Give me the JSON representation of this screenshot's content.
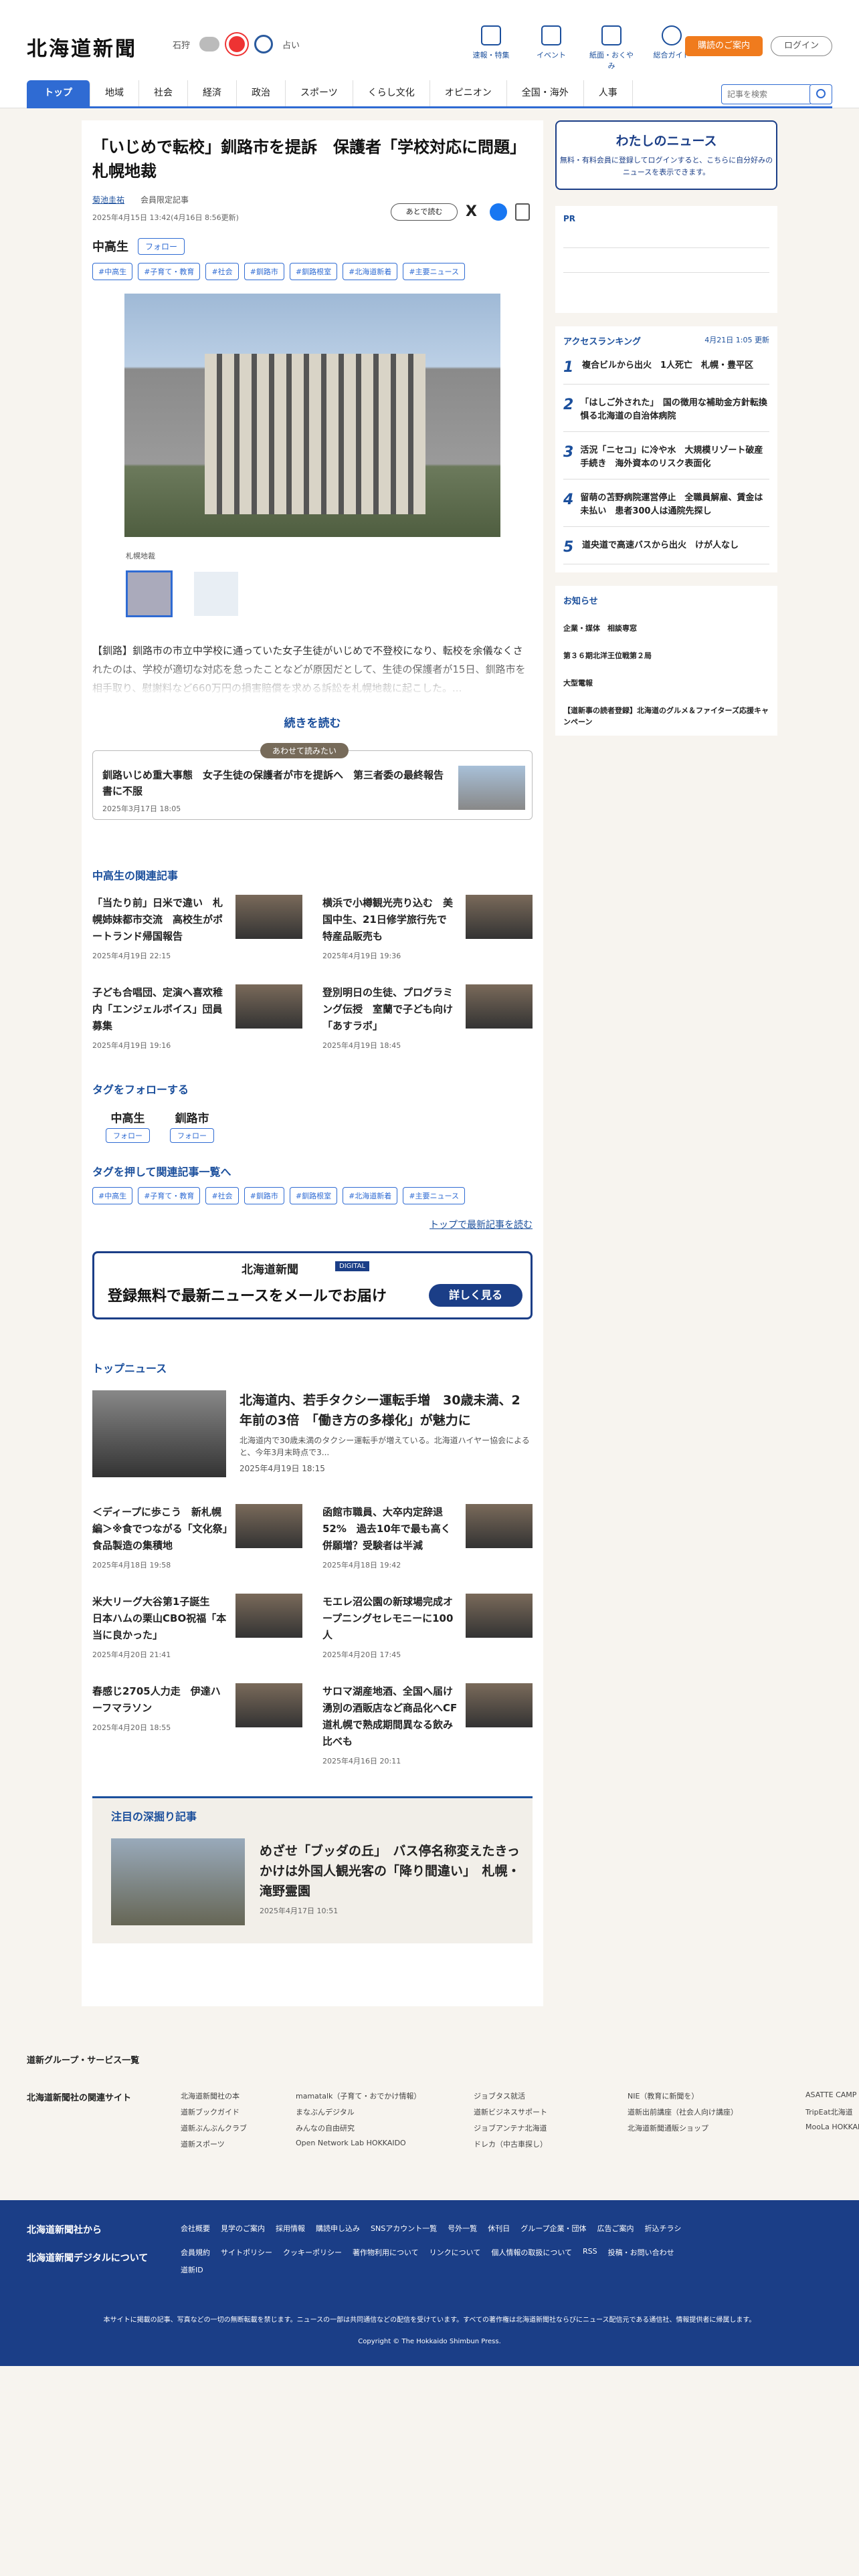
{
  "header": {
    "logo": "北海道新聞",
    "weather_city": "石狩",
    "weather_extra": "占い",
    "top_icons": [
      "速報・特集",
      "イベント",
      "紙面・おくやみ",
      "総合ガイド"
    ],
    "subscribe": "購読のご案内",
    "login": "ログイン",
    "search_placeholder": "記事を検索"
  },
  "nav": [
    "トップ",
    "地域",
    "社会",
    "経済",
    "政治",
    "スポーツ",
    "くらし文化",
    "オピニオン",
    "全国・海外",
    "人事"
  ],
  "article": {
    "title": "「いじめで転校」釧路市を提訴　保護者「学校対応に問題」　札幌地裁",
    "author": "菊池圭祐",
    "member": "会員限定記事",
    "date": "2025年4月15日 13:42(4月16日 8:56更新)",
    "later": "あとで読む",
    "topic": "中高生",
    "follow": "フォロー",
    "tags": [
      "#中高生",
      "#子育て・教育",
      "#社会",
      "#釧路市",
      "#釧路根室",
      "#北海道新着",
      "#主要ニュース"
    ],
    "caption": "札幌地裁",
    "body": "【釧路】釧路市の市立中学校に通っていた女子生徒がいじめで不登校になり、転校を余儀なくされたのは、学校が適切な対応を怠ったことなどが原因だとして、生徒の保護者が15日、釧路市を相手取り、慰謝料など660万円の損害賠償を求める訴訟を札幌地裁に起こした。...",
    "readmore": "続きを読む"
  },
  "also": {
    "label": "あわせて読みたい",
    "title": "釧路いじめ重大事態　女子生徒の保護者が市を提訴へ　第三者委の最終報告書に不服",
    "date": "2025年3月17日 18:05"
  },
  "related_head": "中高生の関連記事",
  "related": [
    {
      "t": "「当たり前」日米で違い　札幌姉妹都市交流　高校生がポートランド帰国報告",
      "d": "2025年4月19日 22:15"
    },
    {
      "t": "横浜で小樽観光売り込む　美国中生、21日修学旅行先で　特産品販売も",
      "d": "2025年4月19日 19:36"
    },
    {
      "t": "子ども合唱団、定演へ喜欢稚内「エンジェルボイス」団員募集",
      "d": "2025年4月19日 19:16"
    },
    {
      "t": "登別明日の生徒、プログラミング伝授　室蘭で子ども向け「あすラボ」",
      "d": "2025年4月19日 18:45"
    }
  ],
  "tagfollow_head": "タグをフォローする",
  "tagfollow": [
    {
      "n": "中高生",
      "f": "フォロー"
    },
    {
      "n": "釧路市",
      "f": "フォロー"
    }
  ],
  "tagsearch_head": "タグを押して関連記事一覧へ",
  "toplink": "トップで最新記事を読む",
  "promo": {
    "logo": "北海道新聞",
    "digital": "DIGITAL",
    "text": "登録無料で最新ニュースをメールでお届け",
    "btn": "詳しく見る"
  },
  "topnews_head": "トップニュース",
  "topnews": {
    "t": "北海道内、若手タクシー運転手増　30歳未満、2年前の3倍　「働き方の多様化」が魅力に",
    "s": "北海道内で30歳未満のタクシー運転手が増えている。北海道ハイヤー協会によると、今年3月末時点で3...",
    "d": "2025年4月19日 18:15"
  },
  "topgrid": [
    {
      "t": "＜ディープに歩こう　新札幌編＞※食でつながる「文化祭」　食品製造の集積地",
      "d": "2025年4月18日 19:58"
    },
    {
      "t": "函館市職員、大卒内定辞退52%　過去10年で最も高く　併願増？受験者は半減",
      "d": "2025年4月18日 19:42"
    },
    {
      "t": "米大リーグ大谷第1子誕生　日本ハムの栗山CBO祝福「本当に良かった」",
      "d": "2025年4月20日 21:41"
    },
    {
      "t": "モエレ沼公園の新球場完成オープニングセレモニーに100人",
      "d": "2025年4月20日 17:45"
    },
    {
      "t": "春感じ2705人力走　伊達ハーフマラソン",
      "d": "2025年4月20日 18:55"
    },
    {
      "t": "サロマ湖産地酒、全国へ届け　湧別の酒販店など商品化へCF　道札幌で熟成期間異なる飲み比べも",
      "d": "2025年4月16日 20:11"
    }
  ],
  "deep": {
    "h": "注目の深掘り記事",
    "t": "めざせ「ブッダの丘」　バス停名称変えたきっかけは外国人観光客の「降り間違い」　札幌・滝野霊園",
    "d": "2025年4月17日 10:51"
  },
  "side": {
    "mynews_h": "わたしのニュース",
    "mynews_s": "無料・有料会員に登録してログインすると、こちらに自分好みのニュースを表示できます。",
    "pr": "PR",
    "rank_h": "アクセスランキング",
    "rank_u": "4月21日 1:05 更新",
    "rank": [
      "複合ビルから出火　1人死亡　札幌・豊平区",
      "「はしご外された」　国の徴用な補助金方針転換　惧る北海道の自治体病院",
      "活況「ニセコ」に冷や水　大規模リゾート破産手続き　海外資本のリスク表面化",
      "留萌の苫野病院運営停止　全職員解雇、賃金は未払い　患者300人は通院先探し",
      "道央道で高速バスから出火　けが人なし"
    ],
    "notice_h": "お知らせ",
    "notices": [
      "企業・媒体　相談専窓",
      "第３６期北洋王位戦第２局",
      "大型電報",
      "【道新事の読者登録】北海道のグルメ＆ファイターズ応援キャンペーン"
    ]
  },
  "footer": {
    "group": "道新グループ・サービス一覧",
    "related_l": "北海道新聞社の関連サイト",
    "cols": [
      "北海道新聞社の本",
      "mamatalk（子育て・おでかけ情報）",
      "ジョブタス就活",
      "NIE（教育に新聞を）",
      "ASATTE CAMP",
      "道新ブックガイド",
      "まなぶんデジタル",
      "道新ビジネスサポート",
      "道新出前講座（社会人向け講座）",
      "TripEat北海道",
      "道新ぶんぶんクラブ",
      "みんなの自由研究",
      "ジョブアンテナ北海道",
      "北海道新聞通販ショップ",
      "MooLa HOKKAIDO",
      "道新スポーツ",
      "Open Network Lab HOKKAIDO",
      "ドレカ（中古車探し）",
      "",
      ""
    ],
    "bf1": "北海道新聞社から",
    "bf2": "北海道新聞デジタルについて",
    "links1": [
      "会社概要",
      "見学のご案内",
      "採用情報",
      "購読申し込み",
      "SNSアカウント一覧",
      "号外一覧",
      "休刊日",
      "グループ企業・団体",
      "広告ご案内",
      "折込チラシ"
    ],
    "links2": [
      "会員規約",
      "サイトポリシー",
      "クッキーポリシー",
      "著作物利用について",
      "リンクについて",
      "個人情報の取扱について",
      "RSS",
      "投稿・お問い合わせ"
    ],
    "links3": "道新ID",
    "note": "本サイトに掲載の記事、写真などの一切の無断転載を禁じます。ニュースの一部は共同通信などの配信を受けています。すべての著作権は北海道新聞社ならびにニュース配信元である通信社、情報提供者に帰属します。",
    "copy": "Copyright © The Hokkaido Shimbun Press."
  }
}
